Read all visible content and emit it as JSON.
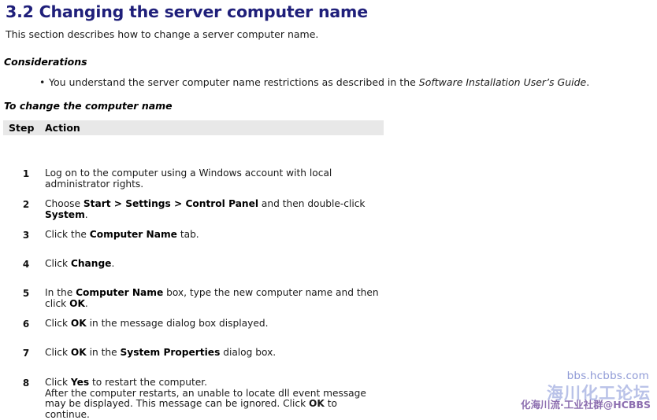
{
  "document": {
    "section_number": "3.2",
    "title": "3.2 Changing the server computer name",
    "title_color": "#1f1f7a",
    "intro": "This section describes how to change a server computer name."
  },
  "considerations": {
    "heading": "Considerations",
    "bullets": [
      {
        "text_before": "You understand the server computer name restrictions as described in the ",
        "italic_text": "Software Installation User’s Guide",
        "text_after": "."
      }
    ]
  },
  "procedure": {
    "heading": "To change the computer name",
    "table": {
      "header_bg": "#e8e8e8",
      "columns": [
        "Step",
        "Action"
      ],
      "rows": [
        {
          "step": "1",
          "parts": [
            {
              "text": "Log on to the computer using a Windows account with local administrator rights.",
              "bold": false
            }
          ]
        },
        {
          "step": "2",
          "parts": [
            {
              "text": "Choose ",
              "bold": false
            },
            {
              "text": "Start > Settings > Control Panel",
              "bold": true
            },
            {
              "text": " and then double-click ",
              "bold": false
            },
            {
              "text": "System",
              "bold": true
            },
            {
              "text": ".",
              "bold": false
            }
          ]
        },
        {
          "step": "3",
          "parts": [
            {
              "text": "Click the ",
              "bold": false
            },
            {
              "text": "Computer Name",
              "bold": true
            },
            {
              "text": " tab.",
              "bold": false
            }
          ]
        },
        {
          "step": "4",
          "parts": [
            {
              "text": "Click ",
              "bold": false
            },
            {
              "text": "Change",
              "bold": true
            },
            {
              "text": ".",
              "bold": false
            }
          ]
        },
        {
          "step": "5",
          "parts": [
            {
              "text": "In the ",
              "bold": false
            },
            {
              "text": "Computer Name",
              "bold": true
            },
            {
              "text": " box, type the new computer name and then click ",
              "bold": false
            },
            {
              "text": "OK",
              "bold": true
            },
            {
              "text": ".",
              "bold": false
            }
          ]
        },
        {
          "step": "6",
          "parts": [
            {
              "text": "Click ",
              "bold": false
            },
            {
              "text": "OK",
              "bold": true
            },
            {
              "text": " in the message dialog box displayed.",
              "bold": false
            }
          ]
        },
        {
          "step": "7",
          "parts": [
            {
              "text": "Click ",
              "bold": false
            },
            {
              "text": "OK",
              "bold": true
            },
            {
              "text": " in the ",
              "bold": false
            },
            {
              "text": "System Properties",
              "bold": true
            },
            {
              "text": " dialog box.",
              "bold": false
            }
          ]
        },
        {
          "step": "8",
          "parts": [
            {
              "text": "Click ",
              "bold": false
            },
            {
              "text": "Yes",
              "bold": true
            },
            {
              "text": " to restart the computer.",
              "bold": false
            }
          ],
          "extra_parts": [
            {
              "text": "After the computer restarts, an unable to locate dll event message may be displayed. This message can be ignored. Click ",
              "bold": false
            },
            {
              "text": "OK",
              "bold": true
            },
            {
              "text": " to continue.",
              "bold": false
            }
          ]
        }
      ]
    }
  },
  "watermark": {
    "url": "bbs.hcbbs.com",
    "url_color": "#8f9ad6",
    "big_text": "海川化工论坛",
    "big_text_color": "#b9c2e8",
    "tagline": "化海川流·工业社群@HCBBS",
    "tagline_color": "#8d6fb0"
  }
}
